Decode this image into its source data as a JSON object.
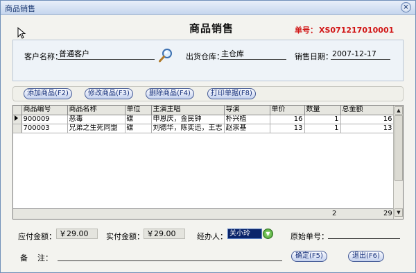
{
  "window": {
    "title": "商品销售",
    "close_glyph": "×"
  },
  "heading": "商品销售",
  "bill": {
    "label": "单号：",
    "value": "XS071217010001"
  },
  "info": {
    "customer_label": "客户名称：",
    "customer_value": "普通客户",
    "warehouse_label": "出货仓库：",
    "warehouse_value": "主仓库",
    "date_label": "销售日期：",
    "date_value": "2007-12-17"
  },
  "toolbar": {
    "add": "添加商品(F2)",
    "edit": "修改商品(F3)",
    "delete": "删除商品(F4)",
    "print": "打印单据(F8)"
  },
  "grid": {
    "columns": [
      "商品编号",
      "商品名称",
      "单位",
      "主演主唱",
      "导演",
      "单价",
      "数量",
      "总金额"
    ],
    "rows": [
      {
        "code": "900009",
        "name": "恶毒",
        "unit": "碟",
        "cast": "申恩庆，金民钟",
        "director": "朴兴植",
        "price": "16",
        "qty": "1",
        "total": "16"
      },
      {
        "code": "700003",
        "name": "兄弟之生死同盟",
        "unit": "碟",
        "cast": "刘德华，陈奕迅，王志",
        "director": "赵崇基",
        "price": "13",
        "qty": "1",
        "total": "13"
      }
    ],
    "footer": {
      "qty": "2",
      "total": "29"
    },
    "scroll_up": "▲",
    "scroll_down": "▼"
  },
  "summary": {
    "payable_label": "应付金额：",
    "payable_value": "￥29.00",
    "paid_label": "实付金额：",
    "paid_value": "￥29.00",
    "handler_label": "经办人：",
    "handler_value": "关小玲",
    "original_label": "原始单号：",
    "original_value": "",
    "note_label": "备    注：",
    "note_value": ""
  },
  "actions": {
    "ok": "确定(F5)",
    "exit": "退出(F6)"
  },
  "icons": {
    "search": "magnifier-icon",
    "dropdown": "green-dropdown-icon",
    "cursor": "arrow-cursor-icon"
  },
  "colors": {
    "bill_number": "#d11616",
    "selected_handler_bg": "#0a246a",
    "button_text": "#16307a"
  }
}
